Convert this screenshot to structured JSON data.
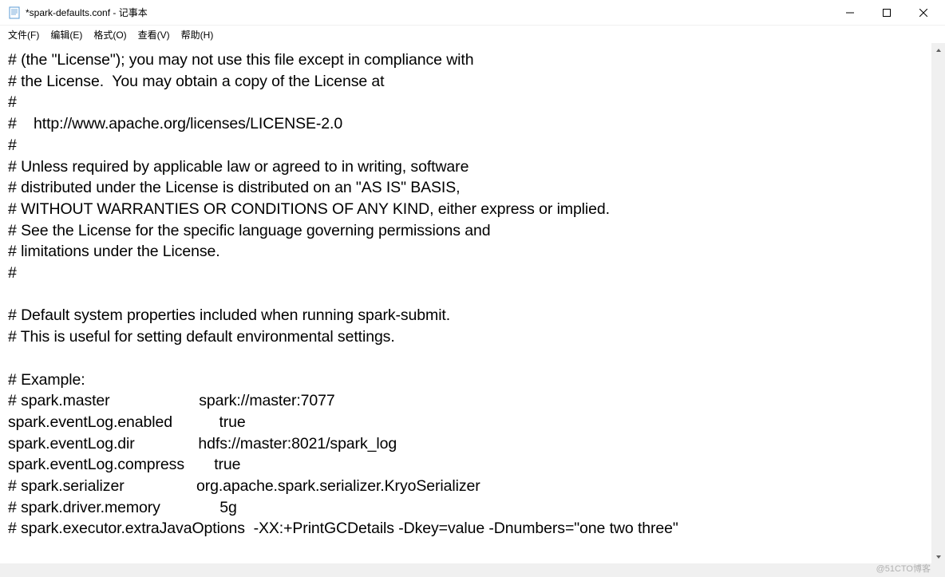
{
  "titlebar": {
    "title": "*spark-defaults.conf - 记事本"
  },
  "menu": {
    "file": "文件(F)",
    "edit": "编辑(E)",
    "format": "格式(O)",
    "view": "查看(V)",
    "help": "帮助(H)"
  },
  "content": {
    "text": "# (the \"License\"); you may not use this file except in compliance with\n# the License.  You may obtain a copy of the License at\n#\n#    http://www.apache.org/licenses/LICENSE-2.0\n#\n# Unless required by applicable law or agreed to in writing, software\n# distributed under the License is distributed on an \"AS IS\" BASIS,\n# WITHOUT WARRANTIES OR CONDITIONS OF ANY KIND, either express or implied.\n# See the License for the specific language governing permissions and\n# limitations under the License.\n#\n\n# Default system properties included when running spark-submit.\n# This is useful for setting default environmental settings.\n\n# Example:\n# spark.master                     spark://master:7077\nspark.eventLog.enabled           true\nspark.eventLog.dir               hdfs://master:8021/spark_log\nspark.eventLog.compress       true\n# spark.serializer                 org.apache.spark.serializer.KryoSerializer\n# spark.driver.memory              5g\n# spark.executor.extraJavaOptions  -XX:+PrintGCDetails -Dkey=value -Dnumbers=\"one two three\""
  },
  "watermark": "@51CTO博客"
}
